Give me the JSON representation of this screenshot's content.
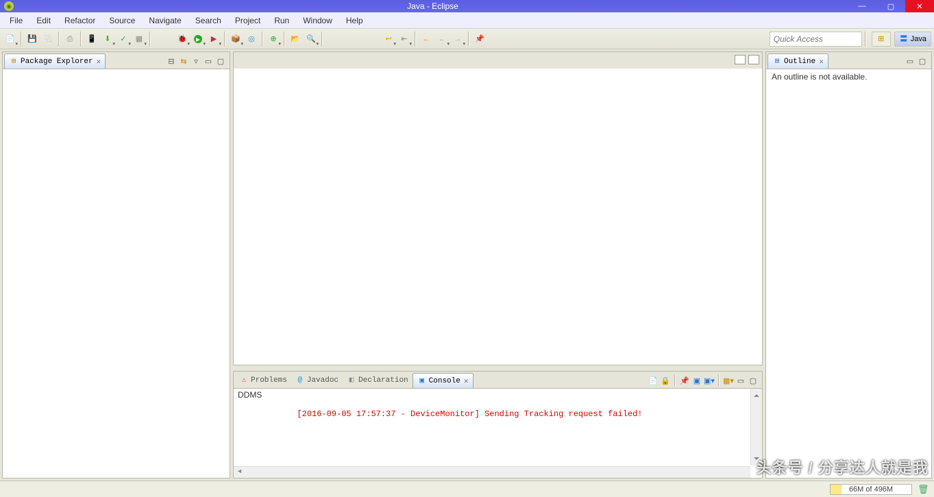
{
  "window": {
    "title": "Java - Eclipse"
  },
  "menu": [
    "File",
    "Edit",
    "Refactor",
    "Source",
    "Navigate",
    "Search",
    "Project",
    "Run",
    "Window",
    "Help"
  ],
  "quick_access_placeholder": "Quick Access",
  "perspective": {
    "label": "Java"
  },
  "views": {
    "package_explorer": {
      "title": "Package Explorer"
    },
    "outline": {
      "title": "Outline",
      "message": "An outline is not available."
    },
    "bottom_tabs": {
      "problems": "Problems",
      "javadoc": "Javadoc",
      "declaration": "Declaration",
      "console": "Console"
    },
    "console": {
      "header": "DDMS",
      "line1": "[2016-09-05 17:57:37 - DeviceMonitor] Sending Tracking request failed!"
    }
  },
  "status": {
    "heap": "66M of 496M"
  },
  "watermark": "头条号 / 分享达人就是我"
}
